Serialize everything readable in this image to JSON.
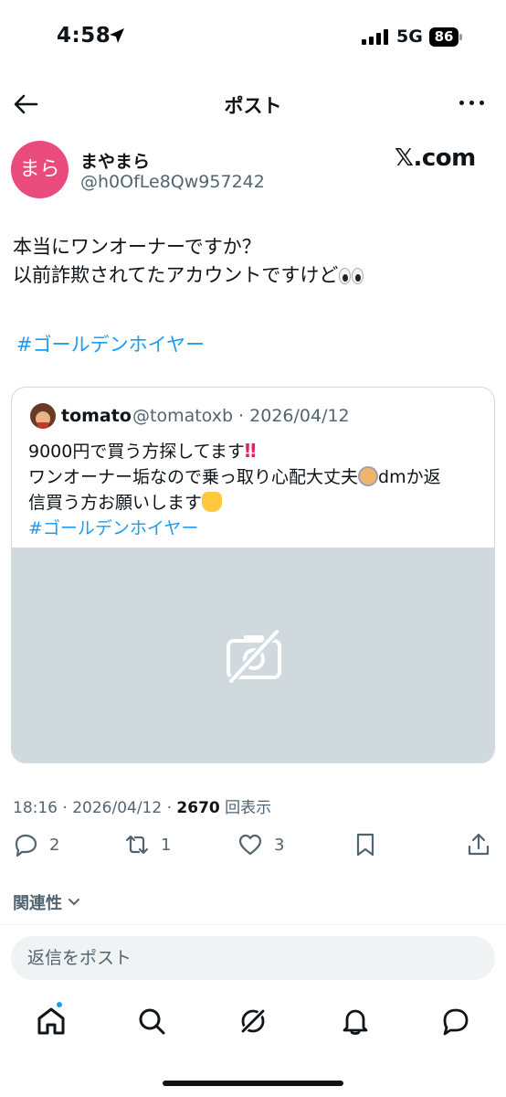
{
  "status_bar": {
    "time": "4:58",
    "network": "5G",
    "battery": "86"
  },
  "header": {
    "title": "ポスト"
  },
  "author": {
    "avatar_text": "まら",
    "avatar_color": "#e94b7c",
    "display_name": "まやまら",
    "handle": "@h0OfLe8Qw957242",
    "badge": "𝕏.com"
  },
  "tweet": {
    "line1": "本当にワンオーナーですか？",
    "line2": "以前詐欺されてたアカウントですけど",
    "hashtag": "#ゴールデンホイヤー"
  },
  "quote": {
    "name": "tomato",
    "handle_date": "@tomatoxb · 2026/04/12",
    "line1": "9000円で買う方探してます",
    "line2a": "ワンオーナー垢なので乗っ取り心配大丈夫",
    "line2b": "dmか返",
    "line3": "信買う方お願いします",
    "hashtag": "#ゴールデンホイヤー"
  },
  "meta": {
    "time_date": "18:16 · 2026/04/12 · ",
    "views": "2670",
    "views_label": " 回表示"
  },
  "actions": {
    "replies": "2",
    "reposts": "1",
    "likes": "3"
  },
  "sort": {
    "label": "関連性"
  },
  "reply": {
    "placeholder": "返信をポスト"
  },
  "colors": {
    "accent": "#1d9bf0",
    "text": "#0f1419",
    "secondary": "#536471"
  }
}
